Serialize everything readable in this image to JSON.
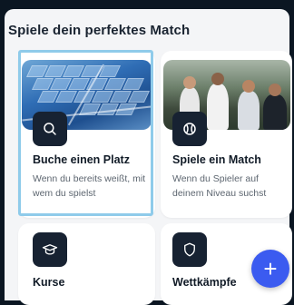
{
  "section": {
    "title": "Spiele dein perfektes Match"
  },
  "cards": [
    {
      "title": "Buche einen Platz",
      "description": "Wenn du bereits weißt, mit wem du spielst",
      "icon": "search-icon"
    },
    {
      "title": "Spiele ein Match",
      "description": "Wenn du Spieler auf deinem Niveau suchst",
      "icon": "tennis-ball-icon"
    },
    {
      "title": "Kurse",
      "icon": "graduation-cap-icon"
    },
    {
      "title": "Wettkämpfe",
      "icon": "shield-icon"
    }
  ],
  "fab": {
    "label": "+",
    "icon": "plus-icon"
  },
  "colors": {
    "background": "#0b1622",
    "panel": "#f4f5f7",
    "icon_badge": "#172232",
    "fab": "#3b5bf0",
    "selection_outline": "#8fcbea"
  }
}
